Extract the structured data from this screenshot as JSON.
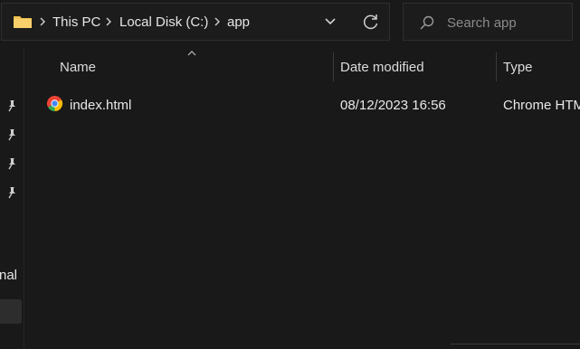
{
  "breadcrumb": {
    "items": [
      "This PC",
      "Local Disk (C:)",
      "app"
    ]
  },
  "search": {
    "placeholder": "Search app"
  },
  "nav": {
    "partial_label": "nal"
  },
  "columns": {
    "name": "Name",
    "date_modified": "Date modified",
    "type": "Type"
  },
  "files": [
    {
      "name": "index.html",
      "date_modified": "08/12/2023 16:56",
      "type": "Chrome HTM"
    }
  ],
  "icons": {
    "folder": "folder-icon",
    "chevron": "chevron-right-icon",
    "dropdown": "chevron-down-icon",
    "refresh": "refresh-icon",
    "search": "search-icon",
    "pin": "pin-icon",
    "sort": "sort-up-icon",
    "file": "chrome-icon"
  },
  "colors": {
    "background": "#191919",
    "folder": "#f2c14e",
    "text": "#e6e6e6"
  }
}
